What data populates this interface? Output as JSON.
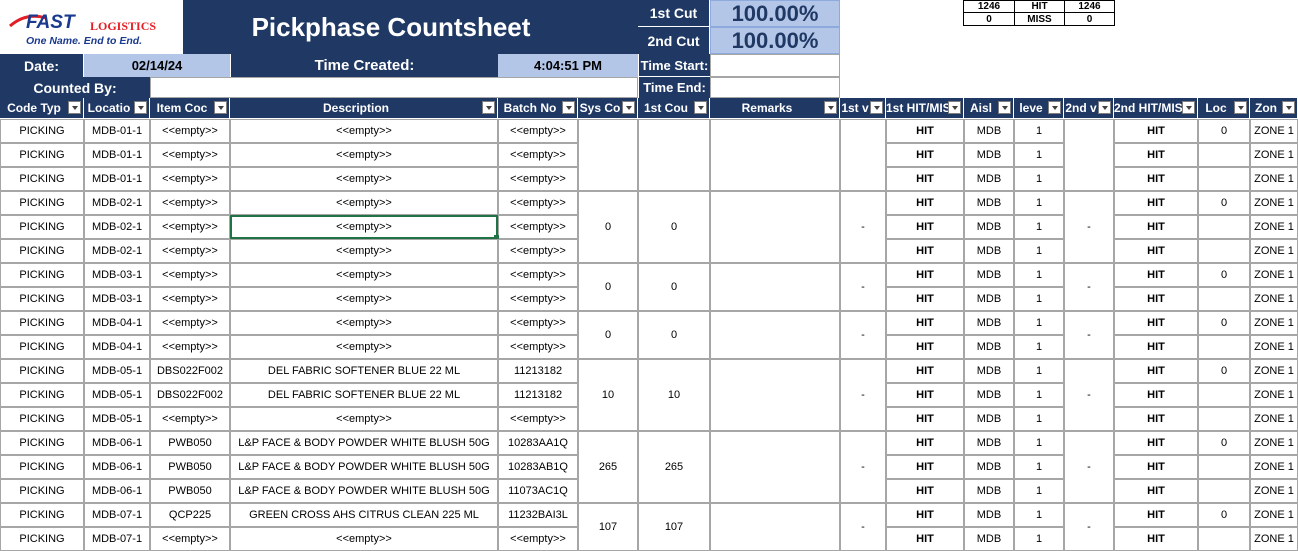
{
  "logo": {
    "brand": "FAST",
    "suffix": "LOGISTICS",
    "tagline": "One Name. End to End."
  },
  "title": "Pickphase Countsheet",
  "cuts": [
    {
      "label": "1st Cut",
      "value": "100.00%"
    },
    {
      "label": "2nd Cut",
      "value": "100.00%"
    }
  ],
  "summary": {
    "r1": [
      "1246",
      "HIT",
      "1246"
    ],
    "r2": [
      "0",
      "MISS",
      "0"
    ]
  },
  "info": {
    "date_label": "Date:",
    "date_value": "02/14/24",
    "time_created_label": "Time Created:",
    "time_created_value": "4:04:51 PM",
    "time_start_label": "Time Start:",
    "time_end_label": "Time End:",
    "counted_by_label": "Counted By:"
  },
  "columns": [
    "Code Typ",
    "Locatio",
    "Item Coc",
    "Description",
    "Batch No",
    "Sys Co",
    "1st Cou",
    "Remarks",
    "1st v",
    "1st HIT/MIS",
    "Aisl",
    "leve",
    "2nd v",
    "2nd HIT/MIS",
    "Loc",
    "Zon"
  ],
  "rows": [
    {
      "code": "PICKING",
      "loc": "MDB-01-1",
      "item": "<<empty>>",
      "desc": "<<empty>>",
      "batch": "<<empty>>",
      "hit1": "HIT",
      "aisle": "MDB",
      "level": "1",
      "hit2": "HIT",
      "locn": "0",
      "zone": "ZONE 1"
    },
    {
      "code": "PICKING",
      "loc": "MDB-01-1",
      "item": "<<empty>>",
      "desc": "<<empty>>",
      "batch": "<<empty>>",
      "hit1": "HIT",
      "aisle": "MDB",
      "level": "1",
      "hit2": "HIT",
      "locn": "",
      "zone": "ZONE 1"
    },
    {
      "code": "PICKING",
      "loc": "MDB-01-1",
      "item": "<<empty>>",
      "desc": "<<empty>>",
      "batch": "<<empty>>",
      "hit1": "HIT",
      "aisle": "MDB",
      "level": "1",
      "hit2": "HIT",
      "locn": "",
      "zone": "ZONE 1"
    },
    {
      "code": "PICKING",
      "loc": "MDB-02-1",
      "item": "<<empty>>",
      "desc": "<<empty>>",
      "batch": "<<empty>>",
      "hit1": "HIT",
      "aisle": "MDB",
      "level": "1",
      "hit2": "HIT",
      "locn": "0",
      "zone": "ZONE 1"
    },
    {
      "code": "PICKING",
      "loc": "MDB-02-1",
      "item": "<<empty>>",
      "desc": "<<empty>>",
      "batch": "<<empty>>",
      "hit1": "HIT",
      "aisle": "MDB",
      "level": "1",
      "hit2": "HIT",
      "locn": "",
      "zone": "ZONE 1"
    },
    {
      "code": "PICKING",
      "loc": "MDB-02-1",
      "item": "<<empty>>",
      "desc": "<<empty>>",
      "batch": "<<empty>>",
      "hit1": "HIT",
      "aisle": "MDB",
      "level": "1",
      "hit2": "HIT",
      "locn": "",
      "zone": "ZONE 1"
    },
    {
      "code": "PICKING",
      "loc": "MDB-03-1",
      "item": "<<empty>>",
      "desc": "<<empty>>",
      "batch": "<<empty>>",
      "hit1": "HIT",
      "aisle": "MDB",
      "level": "1",
      "hit2": "HIT",
      "locn": "0",
      "zone": "ZONE 1"
    },
    {
      "code": "PICKING",
      "loc": "MDB-03-1",
      "item": "<<empty>>",
      "desc": "<<empty>>",
      "batch": "<<empty>>",
      "hit1": "HIT",
      "aisle": "MDB",
      "level": "1",
      "hit2": "HIT",
      "locn": "",
      "zone": "ZONE 1"
    },
    {
      "code": "PICKING",
      "loc": "MDB-04-1",
      "item": "<<empty>>",
      "desc": "<<empty>>",
      "batch": "<<empty>>",
      "hit1": "HIT",
      "aisle": "MDB",
      "level": "1",
      "hit2": "HIT",
      "locn": "0",
      "zone": "ZONE 1"
    },
    {
      "code": "PICKING",
      "loc": "MDB-04-1",
      "item": "<<empty>>",
      "desc": "<<empty>>",
      "batch": "<<empty>>",
      "hit1": "HIT",
      "aisle": "MDB",
      "level": "1",
      "hit2": "HIT",
      "locn": "",
      "zone": "ZONE 1"
    },
    {
      "code": "PICKING",
      "loc": "MDB-05-1",
      "item": "DBS022F002",
      "desc": "DEL FABRIC SOFTENER BLUE 22 ML",
      "batch": "11213182",
      "hit1": "HIT",
      "aisle": "MDB",
      "level": "1",
      "hit2": "HIT",
      "locn": "0",
      "zone": "ZONE 1"
    },
    {
      "code": "PICKING",
      "loc": "MDB-05-1",
      "item": "DBS022F002",
      "desc": "DEL FABRIC SOFTENER BLUE 22 ML",
      "batch": "11213182",
      "hit1": "HIT",
      "aisle": "MDB",
      "level": "1",
      "hit2": "HIT",
      "locn": "",
      "zone": "ZONE 1"
    },
    {
      "code": "PICKING",
      "loc": "MDB-05-1",
      "item": "<<empty>>",
      "desc": "<<empty>>",
      "batch": "<<empty>>",
      "hit1": "HIT",
      "aisle": "MDB",
      "level": "1",
      "hit2": "HIT",
      "locn": "",
      "zone": "ZONE 1"
    },
    {
      "code": "PICKING",
      "loc": "MDB-06-1",
      "item": "PWB050",
      "desc": "L&P FACE & BODY POWDER WHITE BLUSH 50G",
      "batch": "10283AA1Q",
      "hit1": "HIT",
      "aisle": "MDB",
      "level": "1",
      "hit2": "HIT",
      "locn": "0",
      "zone": "ZONE 1"
    },
    {
      "code": "PICKING",
      "loc": "MDB-06-1",
      "item": "PWB050",
      "desc": "L&P FACE & BODY POWDER WHITE BLUSH 50G",
      "batch": "10283AB1Q",
      "hit1": "HIT",
      "aisle": "MDB",
      "level": "1",
      "hit2": "HIT",
      "locn": "",
      "zone": "ZONE 1"
    },
    {
      "code": "PICKING",
      "loc": "MDB-06-1",
      "item": "PWB050",
      "desc": "L&P FACE & BODY POWDER WHITE BLUSH 50G",
      "batch": "11073AC1Q",
      "hit1": "HIT",
      "aisle": "MDB",
      "level": "1",
      "hit2": "HIT",
      "locn": "",
      "zone": "ZONE 1"
    },
    {
      "code": "PICKING",
      "loc": "MDB-07-1",
      "item": "QCP225",
      "desc": "GREEN CROSS AHS CITRUS CLEAN 225 ML",
      "batch": "11232BAI3L",
      "hit1": "HIT",
      "aisle": "MDB",
      "level": "1",
      "hit2": "HIT",
      "locn": "0",
      "zone": "ZONE 1"
    },
    {
      "code": "PICKING",
      "loc": "MDB-07-1",
      "item": "<<empty>>",
      "desc": "<<empty>>",
      "batch": "<<empty>>",
      "hit1": "HIT",
      "aisle": "MDB",
      "level": "1",
      "hit2": "HIT",
      "locn": "",
      "zone": "ZONE 1"
    }
  ],
  "groups": [
    {
      "sys": "",
      "first": "",
      "v1": "",
      "v2": ""
    },
    {
      "sys": "0",
      "first": "0",
      "v1": "-",
      "v2": "-"
    },
    {
      "sys": "0",
      "first": "0",
      "v1": "-",
      "v2": "-"
    },
    {
      "sys": "0",
      "first": "0",
      "v1": "-",
      "v2": "-"
    },
    {
      "sys": "10",
      "first": "10",
      "v1": "-",
      "v2": "-"
    },
    {
      "sys": "265",
      "first": "265",
      "v1": "-",
      "v2": "-"
    },
    {
      "sys": "107",
      "first": "107",
      "v1": "-",
      "v2": "-"
    }
  ]
}
